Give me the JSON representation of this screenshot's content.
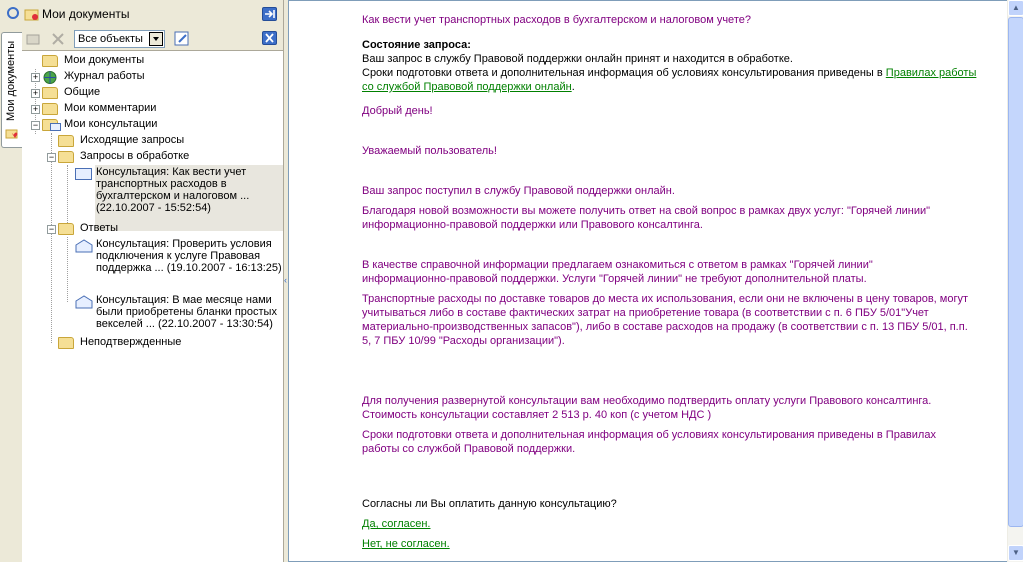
{
  "vertical_tab": {
    "label": "Мои документы"
  },
  "panel": {
    "title": "Мои документы",
    "filter_value": "Все объекты"
  },
  "tree": {
    "root": "Мои документы",
    "journal": "Журнал работы",
    "general": "Общие",
    "comments": "Мои комментарии",
    "consultations": "Мои консультации",
    "outgoing": "Исходящие запросы",
    "processing": "Запросы в обработке",
    "processing_item": "Консультация: Как вести учет транспортных расходов в бухгалтерском и налоговом  ... (22.10.2007 - 15:52:54)",
    "answers": "Ответы",
    "answer_1": "Консультация: Проверить условия подключения к услуге Правовая поддержка  ... (19.10.2007 - 16:13:25)",
    "answer_2": "Консультация: В мае месяце нами были приобретены бланки простых векселей  ... (22.10.2007 - 13:30:54)",
    "unconfirmed": "Неподтвержденные"
  },
  "content": {
    "question": "Как вести учет транспортных расходов в бухгалтерском и налоговом учете?",
    "status_heading": "Состояние запроса:",
    "status_line": "Ваш запрос в службу Правовой поддержки онлайн принят и находится в обработке.",
    "status_terms_prefix": "Сроки подготовки ответа и дополнительная информация об условиях консультирования приведены в ",
    "status_terms_link_1": "Правилах работы",
    "status_terms_link_2": "со службой Правовой поддержки онлайн",
    "status_terms_suffix": ".",
    "greeting": "Добрый день!",
    "dear_user": "Уважаемый пользователь!",
    "received": "Ваш запрос поступил в службу Правовой поддержки онлайн.",
    "opportunity_1": "Благодаря новой возможности вы можете получить ответ на свой вопрос в рамках двух услуг: \"Горячей линии\"",
    "opportunity_2": "информационно-правовой поддержки или Правового консалтинга.",
    "reference_1": "В качестве справочной информации предлагаем ознакомиться с ответом в рамках \"Горячей линии\"",
    "reference_2": "информационно-правовой поддержки. Услуги \"Горячей линии\" не требуют дополнительной платы.",
    "answer_1": "Транспортные расходы по доставке товаров до места их использования, если они не включены в цену товаров, могут",
    "answer_2": "учитываться либо в составе фактических затрат на приобретение товара (в соответствии с п. 6 ПБУ 5/01\"Учет",
    "answer_3": "материально-производственных запасов\"), либо в составе расходов на продажу (в соответствии с п. 13 ПБУ 5/01, п.п.",
    "answer_4": "5, 7 ПБУ 10/99 \"Расходы организации\").",
    "extended_1": "Для получения развернутой консультации вам необходимо подтвердить оплату услуги Правового консалтинга.",
    "extended_2": "Стоимость консультации составляет 2 513 р. 40 коп (с учетом НДС )",
    "terms_1": " Сроки подготовки ответа и дополнительная информация об условиях консультирования приведены в Правилах",
    "terms_2": "работы со службой Правовой поддержки.",
    "agree_question": "Согласны ли Вы оплатить данную консультацию?",
    "yes_link": "Да, согласен.",
    "no_link": "Нет, не согласен."
  }
}
